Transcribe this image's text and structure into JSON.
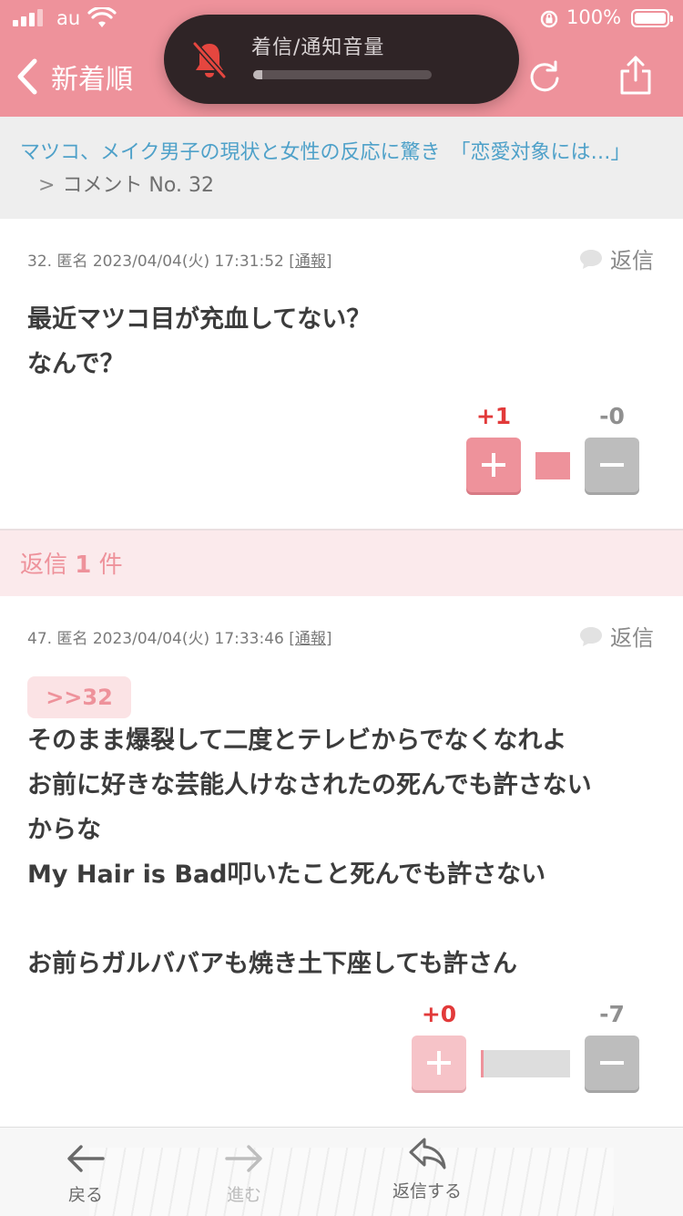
{
  "status_bar": {
    "carrier": "au",
    "battery": "100%"
  },
  "nav": {
    "back_label": "新着順"
  },
  "volume_hud": {
    "title": "着信/通知音量",
    "level": 0.05
  },
  "breadcrumb": {
    "link": "マツコ、メイク男子の現状と女性の反応に驚き　「恋愛対象には…」",
    "separator": ">",
    "current": "コメント No. 32"
  },
  "comments": [
    {
      "number": "32.",
      "author": "匿名",
      "datetime": "2023/04/04(火) 17:31:52",
      "report_label": "[通報]",
      "reply_label": "返信",
      "lines": [
        "最近マツコ目が充血してない？",
        "なんで？"
      ],
      "plus": "+1",
      "minus": "-0",
      "plus_ratio": 1.0
    },
    {
      "number": "47.",
      "author": "匿名",
      "datetime": "2023/04/04(火) 17:33:46",
      "report_label": "[通報]",
      "reply_label": "返信",
      "anchor": ">>32",
      "lines": [
        "そのまま爆裂して二度とテレビからでなくなれよ",
        "お前に好きな芸能人けなされたの死んでも許さない",
        "からな",
        "My Hair is Bad叩いたこと死んでも許さない",
        "",
        "お前らガルババアも焼き土下座しても許さん"
      ],
      "plus": "+0",
      "minus": "-7",
      "plus_ratio": 0.0
    }
  ],
  "replies_bar": {
    "prefix": "返信",
    "count": "1",
    "suffix": "件"
  },
  "toolbar": {
    "back": "戻る",
    "forward": "進む",
    "reply": "返信する"
  },
  "colors": {
    "brand_pink": "#ee929b",
    "link_blue": "#4fa1c9",
    "plus_red": "#e23a3a"
  }
}
